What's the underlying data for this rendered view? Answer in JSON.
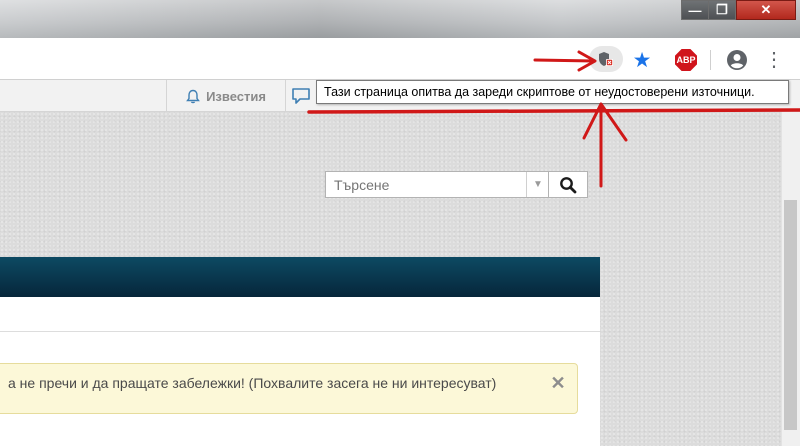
{
  "window": {
    "minimize_glyph": "—",
    "maximize_glyph": "❐",
    "close_glyph": "✕"
  },
  "toolbar": {
    "icons": [
      "shield-blocked-icon",
      "bookmark-star-icon",
      "adblock-plus-icon",
      "account-icon",
      "menu-icon"
    ],
    "abp_label": "ABP",
    "star_glyph": "★",
    "menu_glyph": "⋮"
  },
  "sitebar": {
    "notifications_label": "Известия"
  },
  "tooltip": {
    "text": "Тази страница опитва да зареди скриптове от неудостоверени източници."
  },
  "search": {
    "placeholder": "Търсене",
    "dropdown_glyph": "▼"
  },
  "notice": {
    "text": "а не пречи и да пращате забележки! (Похвалите засега не ни интересуват)",
    "close_glyph": "✕"
  },
  "colors": {
    "accent_blue": "#1a73e8",
    "abp_red": "#d0141c",
    "nav_dark": "#06263a",
    "annotation_red": "#d01818",
    "notice_bg": "#fcf8d8"
  }
}
